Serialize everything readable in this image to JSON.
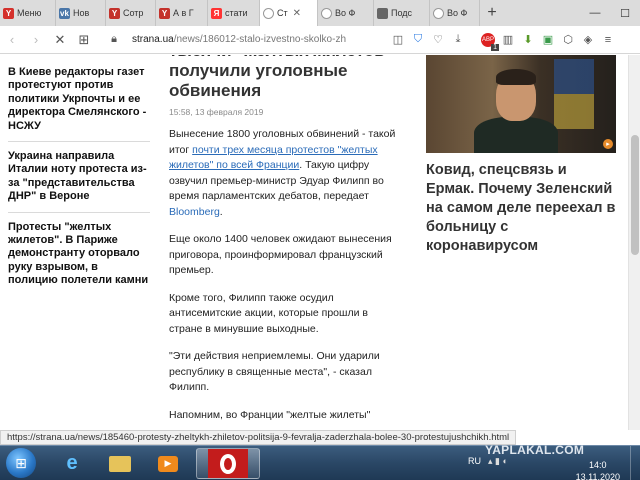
{
  "tabs": [
    {
      "label": "Меню",
      "fav_text": "Y",
      "fav_color": "#d4302b",
      "active": false
    },
    {
      "label": "Нов",
      "fav_text": "vk",
      "fav_color": "#4a76a8",
      "active": false
    },
    {
      "label": "Сотр",
      "fav_text": "Y",
      "fav_color": "#c4322b",
      "active": false
    },
    {
      "label": "А в Г",
      "fav_text": "Y",
      "fav_color": "#c4322b",
      "active": false
    },
    {
      "label": "стати",
      "fav_text": "Я",
      "fav_color": "#ff3333",
      "active": false
    },
    {
      "label": "Ст",
      "fav_text": "",
      "fav_color": "#999999",
      "active": true
    },
    {
      "label": "Во Ф",
      "fav_text": "",
      "fav_color": "#999999",
      "active": false
    },
    {
      "label": "Подс",
      "fav_text": "",
      "fav_color": "#666666",
      "active": false
    },
    {
      "label": "Во Ф",
      "fav_text": "",
      "fav_color": "#999999",
      "active": false
    }
  ],
  "url": {
    "host": "strana.ua",
    "path": "/news/186012-stalo-izvestno-skolko-zh"
  },
  "extensions": {
    "badge": "1"
  },
  "left_news": [
    "В Киеве редакторы газет протестуют против политики Укрпочты и ее директора Смелянского - НСЖУ",
    "Украина направила Италии ноту протеста из-за \"представительства ДНР\" в Вероне",
    "Протесты \"желтых жилетов\". В Париже демонстранту оторвало руку взрывом, в полицию полетели камни"
  ],
  "article": {
    "title": "тысячи \"желтых жилетов\" получили уголовные обвинения",
    "date": "15:58, 13 февраля 2019",
    "p1_start": "Вынесение 1800 уголовных обвинений - такой итог ",
    "p1_link": "почти трех месяца протестов \"желтых жилетов\" по всей Франции",
    "p1_mid": ". Такую цифру озвучил премьер-министр Эдуар Филипп во время парламентских дебатов, передает ",
    "p1_source": "Bloomberg",
    "p1_end": ".",
    "p2": "Еще около 1400 человек ожидают вынесения приговора, проинформировал французский премьер.",
    "p3": "Кроме того, Филипп также осудил антисемитские акции, которые прошли в стране в минувшие выходные.",
    "p4": "\"Эти действия неприемлемы. Они ударили республику в священные места\", - сказал Филипп.",
    "p5": "Напомним, во Франции \"желтые жилеты\""
  },
  "side_story": {
    "title": "Ковид, спецсвязь и Ермак. Почему Зеленский на самом деле переехал в больницу с коронавирусом"
  },
  "status_url": "https://strana.ua/news/185460-protesty-zheltykh-zhiletov-politsija-9-fevralja-zaderzhala-bolee-30-protestujushchikh.html",
  "taskbar": {
    "lang": "RU",
    "clock_time": "14:0",
    "clock_date": "13.11.2020",
    "watermark": "YAPLAKAL.COM"
  }
}
